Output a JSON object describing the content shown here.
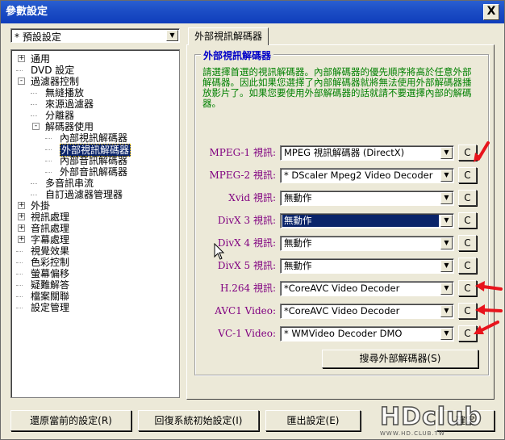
{
  "window": {
    "title": "參數設定",
    "close_symbol": "X"
  },
  "preset": {
    "value": "* 預設設定"
  },
  "tree": {
    "items": [
      {
        "label": "通用",
        "expander": "+"
      },
      {
        "label": "DVD 設定",
        "expander": ""
      },
      {
        "label": "過濾器控制",
        "expander": "-"
      },
      {
        "label": "無縫播放",
        "expander": ""
      },
      {
        "label": "來源過濾器",
        "expander": ""
      },
      {
        "label": "分離器",
        "expander": ""
      },
      {
        "label": "解碼器使用",
        "expander": "-"
      },
      {
        "label": "內部視訊解碼器",
        "expander": ""
      },
      {
        "label": "外部視訊解碼器",
        "expander": ""
      },
      {
        "label": "內部音訊解碼器",
        "expander": ""
      },
      {
        "label": "外部音訊解碼器",
        "expander": ""
      },
      {
        "label": "多音訊串流",
        "expander": ""
      },
      {
        "label": "自訂過濾器管理器",
        "expander": ""
      },
      {
        "label": "外掛",
        "expander": "+"
      },
      {
        "label": "視訊處理",
        "expander": "+"
      },
      {
        "label": "音訊處理",
        "expander": "+"
      },
      {
        "label": "字幕處理",
        "expander": "+"
      },
      {
        "label": "視覺效果",
        "expander": ""
      },
      {
        "label": "色彩控制",
        "expander": ""
      },
      {
        "label": "螢幕偏移",
        "expander": ""
      },
      {
        "label": "疑難解答",
        "expander": ""
      },
      {
        "label": "檔案關聯",
        "expander": ""
      },
      {
        "label": "設定管理",
        "expander": ""
      }
    ]
  },
  "tab": {
    "label": "外部視訊解碼器"
  },
  "group": {
    "title": "外部視訊解碼器",
    "description": "請選擇首選的視訊解碼器。內部解碼器的優先順序將高於任意外部解碼器。因此如果您選擇了內部解碼器就將無法使用外部解碼器播放影片了。如果您要使用外部解碼器的話就請不要選擇內部的解碼器。"
  },
  "decoders": [
    {
      "label": "MPEG-1 視訊:",
      "value": "MPEG 視訊解碼器 (DirectX)",
      "button": "C",
      "highlight": false
    },
    {
      "label": "MPEG-2 視訊:",
      "value": "* DScaler Mpeg2 Video Decoder",
      "button": "C",
      "highlight": false
    },
    {
      "label": "Xvid 視訊:",
      "value": "無動作",
      "button": "C",
      "highlight": false
    },
    {
      "label": "DivX 3 視訊:",
      "value": "無動作",
      "button": "C",
      "highlight": true
    },
    {
      "label": "DivX 4 視訊:",
      "value": "無動作",
      "button": "C",
      "highlight": false
    },
    {
      "label": "DivX 5 視訊:",
      "value": "無動作",
      "button": "C",
      "highlight": false
    },
    {
      "label": "H.264 視訊:",
      "value": "*CoreAVC Video Decoder",
      "button": "C",
      "highlight": false
    },
    {
      "label": "AVC1 Video:",
      "value": "*CoreAVC Video Decoder",
      "button": "C",
      "highlight": false
    },
    {
      "label": "VC-1 Video:",
      "value": "* WMVideo Decoder DMO",
      "button": "C",
      "highlight": false
    }
  ],
  "search_button": "搜尋外部解碼器(S)",
  "bottom_buttons": {
    "restore": "還原當前的設定(R)",
    "reset": "回復系統初始設定(I)",
    "export": "匯出設定(E)",
    "ok": "確定"
  },
  "watermark": {
    "logo": "HDclub",
    "url": "WWW.HD.CLUB.TW"
  },
  "colors": {
    "title_bar": "#1d4fc6",
    "group_title": "#0000c8",
    "description": "#008000",
    "row_label": "#800080",
    "selection": "#0a246a",
    "annotation_arrow": "#e8141c"
  }
}
